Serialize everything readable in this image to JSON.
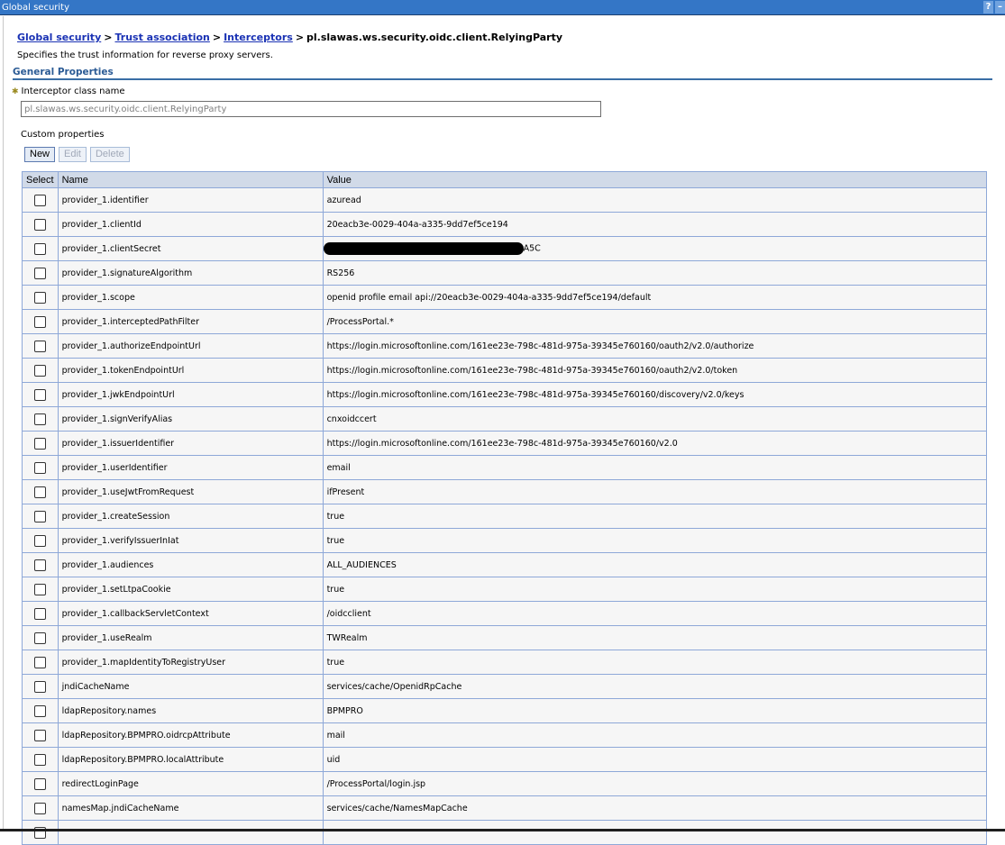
{
  "window": {
    "title": "Global security",
    "help_label": "?",
    "minimize_label": "–"
  },
  "breadcrumb": {
    "items": [
      "Global security",
      "Trust association",
      "Interceptors"
    ],
    "separator": ">",
    "current": "pl.slawas.ws.security.oidc.client.RelyingParty"
  },
  "description": "Specifies the trust information for reverse proxy servers.",
  "general_properties": {
    "title": "General Properties",
    "required_icon": "required-asterisk-icon",
    "interceptor_label": "Interceptor class name",
    "interceptor_value": "pl.slawas.ws.security.oidc.client.RelyingParty"
  },
  "custom_properties": {
    "label": "Custom properties",
    "buttons": {
      "new": "New",
      "edit": "Edit",
      "delete": "Delete"
    },
    "columns": [
      "Select",
      "Name",
      "Value"
    ],
    "rows": [
      {
        "name": "provider_1.identifier",
        "value": "azuread"
      },
      {
        "name": "provider_1.clientId",
        "value": "20eacb3e-0029-404a-a335-9dd7ef5ce194"
      },
      {
        "name": "provider_1.clientSecret",
        "value": "A5C",
        "redacted": true
      },
      {
        "name": "provider_1.signatureAlgorithm",
        "value": "RS256"
      },
      {
        "name": "provider_1.scope",
        "value": "openid profile email api://20eacb3e-0029-404a-a335-9dd7ef5ce194/default"
      },
      {
        "name": "provider_1.interceptedPathFilter",
        "value": "/ProcessPortal.*"
      },
      {
        "name": "provider_1.authorizeEndpointUrl",
        "value": "https://login.microsoftonline.com/161ee23e-798c-481d-975a-39345e760160/oauth2/v2.0/authorize"
      },
      {
        "name": "provider_1.tokenEndpointUrl",
        "value": "https://login.microsoftonline.com/161ee23e-798c-481d-975a-39345e760160/oauth2/v2.0/token"
      },
      {
        "name": "provider_1.jwkEndpointUrl",
        "value": "https://login.microsoftonline.com/161ee23e-798c-481d-975a-39345e760160/discovery/v2.0/keys"
      },
      {
        "name": "provider_1.signVerifyAlias",
        "value": "cnxoidccert"
      },
      {
        "name": "provider_1.issuerIdentifier",
        "value": "https://login.microsoftonline.com/161ee23e-798c-481d-975a-39345e760160/v2.0"
      },
      {
        "name": "provider_1.userIdentifier",
        "value": "email"
      },
      {
        "name": "provider_1.useJwtFromRequest",
        "value": "ifPresent"
      },
      {
        "name": "provider_1.createSession",
        "value": "true"
      },
      {
        "name": "provider_1.verifyIssuerInIat",
        "value": "true"
      },
      {
        "name": "provider_1.audiences",
        "value": "ALL_AUDIENCES"
      },
      {
        "name": "provider_1.setLtpaCookie",
        "value": "true"
      },
      {
        "name": "provider_1.callbackServletContext",
        "value": "/oidcclient"
      },
      {
        "name": "provider_1.useRealm",
        "value": "TWRealm"
      },
      {
        "name": "provider_1.mapIdentityToRegistryUser",
        "value": "true"
      },
      {
        "name": "jndiCacheName",
        "value": "services/cache/OpenidRpCache"
      },
      {
        "name": "ldapRepository.names",
        "value": "BPMPRO"
      },
      {
        "name": "ldapRepository.BPMPRO.oidrcpAttribute",
        "value": "mail"
      },
      {
        "name": "ldapRepository.BPMPRO.localAttribute",
        "value": "uid"
      },
      {
        "name": "redirectLoginPage",
        "value": "/ProcessPortal/login.jsp"
      },
      {
        "name": "namesMap.jndiCacheName",
        "value": "services/cache/NamesMapCache"
      },
      {
        "name": "",
        "value": ""
      }
    ]
  }
}
